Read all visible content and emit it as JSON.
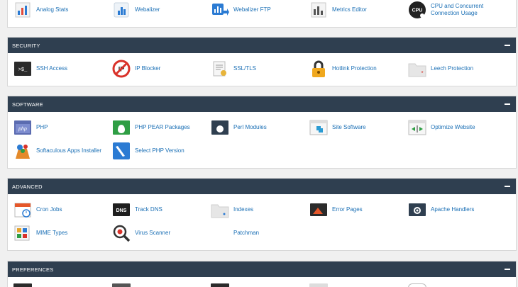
{
  "metrics": {
    "items": [
      {
        "label": "Analog Stats",
        "icon": "analog-stats-icon"
      },
      {
        "label": "Webalizer",
        "icon": "webalizer-icon"
      },
      {
        "label": "Webalizer FTP",
        "icon": "webalizer-ftp-icon"
      },
      {
        "label": "Metrics Editor",
        "icon": "metrics-editor-icon"
      },
      {
        "label": "CPU and Concurrent Connection Usage",
        "icon": "cpu-usage-icon",
        "icon_text": "CPU"
      }
    ]
  },
  "security": {
    "title": "SECURITY",
    "items": [
      {
        "label": "SSH Access",
        "icon": "terminal-icon",
        "icon_text": ">$_"
      },
      {
        "label": "IP Blocker",
        "icon": "ip-blocker-icon",
        "icon_text": "IP"
      },
      {
        "label": "SSL/TLS",
        "icon": "ssl-certificate-icon"
      },
      {
        "label": "Hotlink Protection",
        "icon": "padlock-icon"
      },
      {
        "label": "Leech Protection",
        "icon": "folder-leech-icon"
      }
    ]
  },
  "software": {
    "title": "SOFTWARE",
    "items": [
      {
        "label": "PHP",
        "icon": "php-icon",
        "icon_text": "php"
      },
      {
        "label": "PHP PEAR Packages",
        "icon": "php-pear-icon"
      },
      {
        "label": "Perl Modules",
        "icon": "perl-modules-icon"
      },
      {
        "label": "Site Software",
        "icon": "site-software-icon"
      },
      {
        "label": "Optimize Website",
        "icon": "optimize-website-icon"
      },
      {
        "label": "Softaculous Apps Installer",
        "icon": "softaculous-icon"
      },
      {
        "label": "Select PHP Version",
        "icon": "select-php-version-icon"
      }
    ]
  },
  "advanced": {
    "title": "ADVANCED",
    "items": [
      {
        "label": "Cron Jobs",
        "icon": "calendar-icon"
      },
      {
        "label": "Track DNS",
        "icon": "dns-icon",
        "icon_text": "DNS"
      },
      {
        "label": "Indexes",
        "icon": "folder-index-icon"
      },
      {
        "label": "Error Pages",
        "icon": "error-pages-icon"
      },
      {
        "label": "Apache Handlers",
        "icon": "apache-handlers-icon"
      },
      {
        "label": "MIME Types",
        "icon": "mime-types-icon"
      },
      {
        "label": "Virus Scanner",
        "icon": "virus-scanner-icon"
      },
      {
        "label": "Patchman",
        "icon": ""
      }
    ]
  },
  "preferences": {
    "title": "PREFERENCES"
  },
  "colors": {
    "header_bg": "#2f3f50",
    "link": "#1a6fb5"
  }
}
